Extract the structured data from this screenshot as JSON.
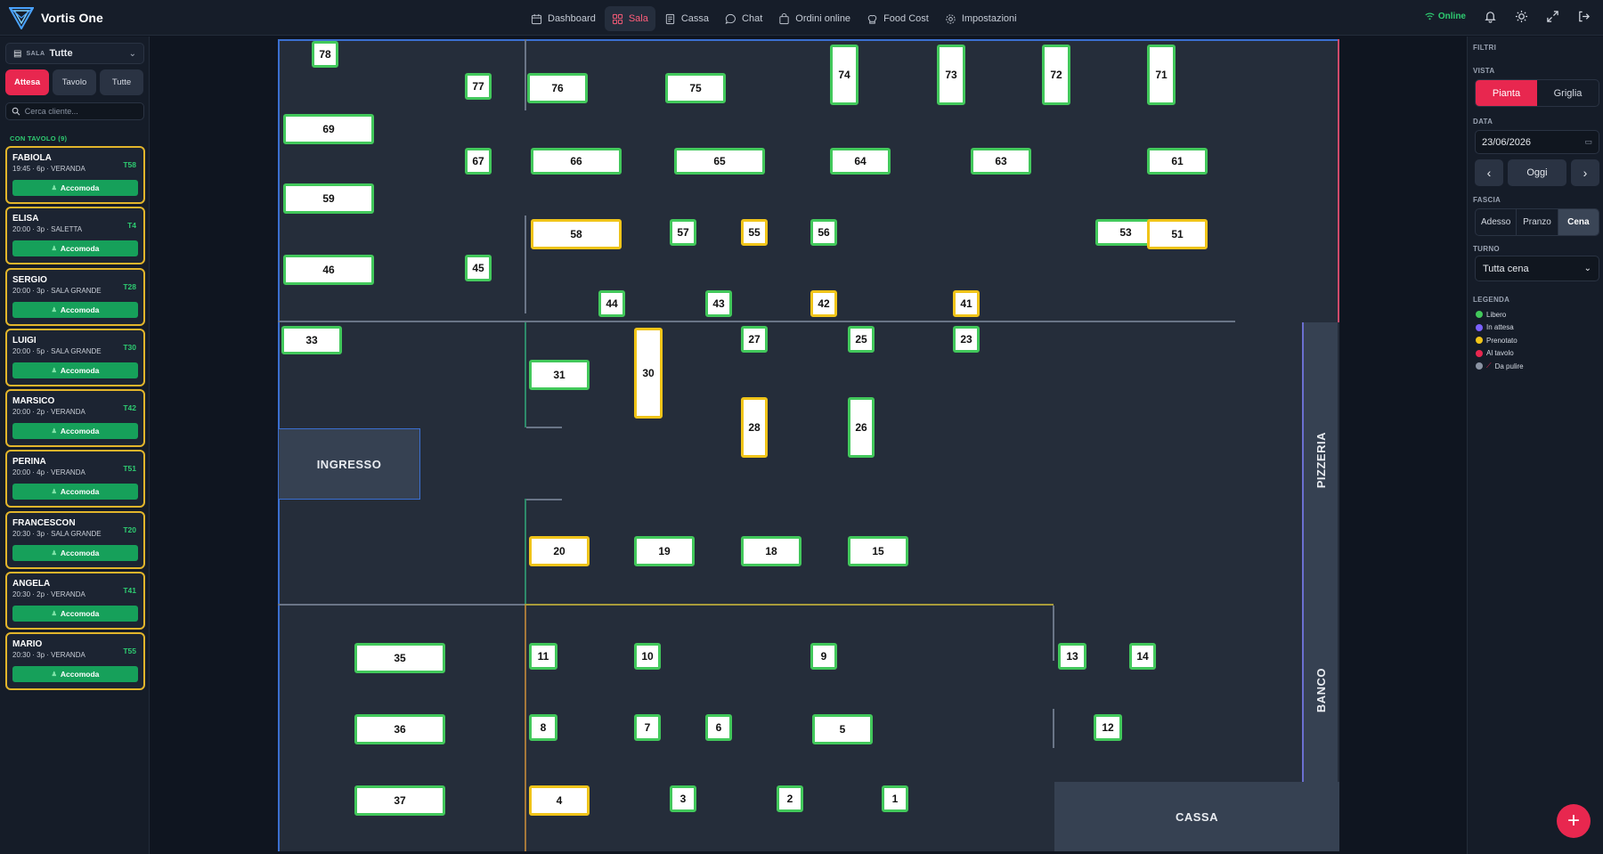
{
  "app": {
    "title": "Vortis One"
  },
  "nav": [
    {
      "label": "Dashboard",
      "icon": "calendar-icon"
    },
    {
      "label": "Sala",
      "icon": "grid-icon"
    },
    {
      "label": "Cassa",
      "icon": "receipt-icon"
    },
    {
      "label": "Chat",
      "icon": "chat-icon"
    },
    {
      "label": "Ordini online",
      "icon": "bag-icon"
    },
    {
      "label": "Food Cost",
      "icon": "chef-hat-icon"
    },
    {
      "label": "Impostazioni",
      "icon": "gear-icon"
    }
  ],
  "status": {
    "online": "Online"
  },
  "sidebar": {
    "sala_label": "SALA",
    "sala_value": "Tutte",
    "tabs": [
      "Attesa",
      "Tavolo",
      "Tutte"
    ],
    "search_placeholder": "Cerca cliente...",
    "section_title": "CON TAVOLO (9)",
    "action_label": "Accomoda",
    "reservations": [
      {
        "name": "FABIOLA",
        "info": "19:45 · 6p · VERANDA",
        "table": "T58"
      },
      {
        "name": "ELISA",
        "info": "20:00 · 3p · SALETTA",
        "table": "T4"
      },
      {
        "name": "SERGIO",
        "info": "20:00 · 3p · SALA GRANDE",
        "table": "T28"
      },
      {
        "name": "LUIGI",
        "info": "20:00 · 5p · SALA GRANDE",
        "table": "T30"
      },
      {
        "name": "MARSICO",
        "info": "20:00 · 2p · VERANDA",
        "table": "T42"
      },
      {
        "name": "PERINA",
        "info": "20:00 · 4p · VERANDA",
        "table": "T51"
      },
      {
        "name": "FRANCESCON",
        "info": "20:30 · 3p · SALA GRANDE",
        "table": "T20"
      },
      {
        "name": "ANGELA",
        "info": "20:30 · 2p · VERANDA",
        "table": "T41"
      },
      {
        "name": "MARIO",
        "info": "20:30 · 3p · VERANDA",
        "table": "T55"
      }
    ]
  },
  "map": {
    "zones": {
      "ingresso": "INGRESSO",
      "pizzeria": "PIZZERIA",
      "banco": "BANCO",
      "cassa": "CASSA"
    },
    "colors": {
      "libero": "#42c85b",
      "prenotato": "#f0c419",
      "in_attesa": "#7b61ff",
      "al_tavolo": "#e8274f",
      "da_pulire": "#8a93a3"
    },
    "tables": [
      {
        "n": "78",
        "s": "libero"
      },
      {
        "n": "77",
        "s": "libero"
      },
      {
        "n": "76",
        "s": "libero"
      },
      {
        "n": "75",
        "s": "libero"
      },
      {
        "n": "74",
        "s": "libero"
      },
      {
        "n": "73",
        "s": "libero"
      },
      {
        "n": "72",
        "s": "libero"
      },
      {
        "n": "71",
        "s": "libero"
      },
      {
        "n": "69",
        "s": "libero"
      },
      {
        "n": "67",
        "s": "libero"
      },
      {
        "n": "66",
        "s": "libero"
      },
      {
        "n": "65",
        "s": "libero"
      },
      {
        "n": "64",
        "s": "libero"
      },
      {
        "n": "63",
        "s": "libero"
      },
      {
        "n": "61",
        "s": "libero"
      },
      {
        "n": "59",
        "s": "libero"
      },
      {
        "n": "58",
        "s": "prenotato"
      },
      {
        "n": "57",
        "s": "libero"
      },
      {
        "n": "55",
        "s": "prenotato"
      },
      {
        "n": "56",
        "s": "libero"
      },
      {
        "n": "53",
        "s": "libero"
      },
      {
        "n": "51",
        "s": "prenotato"
      },
      {
        "n": "46",
        "s": "libero"
      },
      {
        "n": "45",
        "s": "libero"
      },
      {
        "n": "44",
        "s": "libero"
      },
      {
        "n": "43",
        "s": "libero"
      },
      {
        "n": "42",
        "s": "prenotato"
      },
      {
        "n": "41",
        "s": "prenotato"
      },
      {
        "n": "33",
        "s": "libero"
      },
      {
        "n": "27",
        "s": "libero"
      },
      {
        "n": "25",
        "s": "libero"
      },
      {
        "n": "23",
        "s": "libero"
      },
      {
        "n": "31",
        "s": "libero"
      },
      {
        "n": "30",
        "s": "prenotato"
      },
      {
        "n": "28",
        "s": "prenotato"
      },
      {
        "n": "26",
        "s": "libero"
      },
      {
        "n": "20",
        "s": "prenotato"
      },
      {
        "n": "19",
        "s": "libero"
      },
      {
        "n": "18",
        "s": "libero"
      },
      {
        "n": "15",
        "s": "libero"
      },
      {
        "n": "35",
        "s": "libero"
      },
      {
        "n": "11",
        "s": "libero"
      },
      {
        "n": "10",
        "s": "libero"
      },
      {
        "n": "9",
        "s": "libero"
      },
      {
        "n": "13",
        "s": "libero"
      },
      {
        "n": "14",
        "s": "libero"
      },
      {
        "n": "36",
        "s": "libero"
      },
      {
        "n": "8",
        "s": "libero"
      },
      {
        "n": "7",
        "s": "libero"
      },
      {
        "n": "6",
        "s": "libero"
      },
      {
        "n": "5",
        "s": "libero"
      },
      {
        "n": "12",
        "s": "libero"
      },
      {
        "n": "37",
        "s": "libero"
      },
      {
        "n": "4",
        "s": "prenotato"
      },
      {
        "n": "3",
        "s": "libero"
      },
      {
        "n": "2",
        "s": "libero"
      },
      {
        "n": "1",
        "s": "libero"
      }
    ]
  },
  "filters": {
    "title": "FILTRI",
    "vista_label": "VISTA",
    "vista_options": [
      "Pianta",
      "Griglia"
    ],
    "data_label": "DATA",
    "date_value": "23/06/2026",
    "today_label": "Oggi",
    "fascia_label": "FASCIA",
    "fascia_options": [
      "Adesso",
      "Pranzo",
      "Cena"
    ],
    "turno_label": "TURNO",
    "turno_value": "Tutta cena",
    "legend_label": "LEGENDA",
    "legend": [
      {
        "label": "Libero",
        "color": "#42c85b"
      },
      {
        "label": "In attesa",
        "color": "#7b61ff"
      },
      {
        "label": "Prenotato",
        "color": "#f0c419"
      },
      {
        "label": "Al tavolo",
        "color": "#e8274f"
      },
      {
        "label": "Da pulire",
        "color": "#8a93a3"
      }
    ]
  }
}
